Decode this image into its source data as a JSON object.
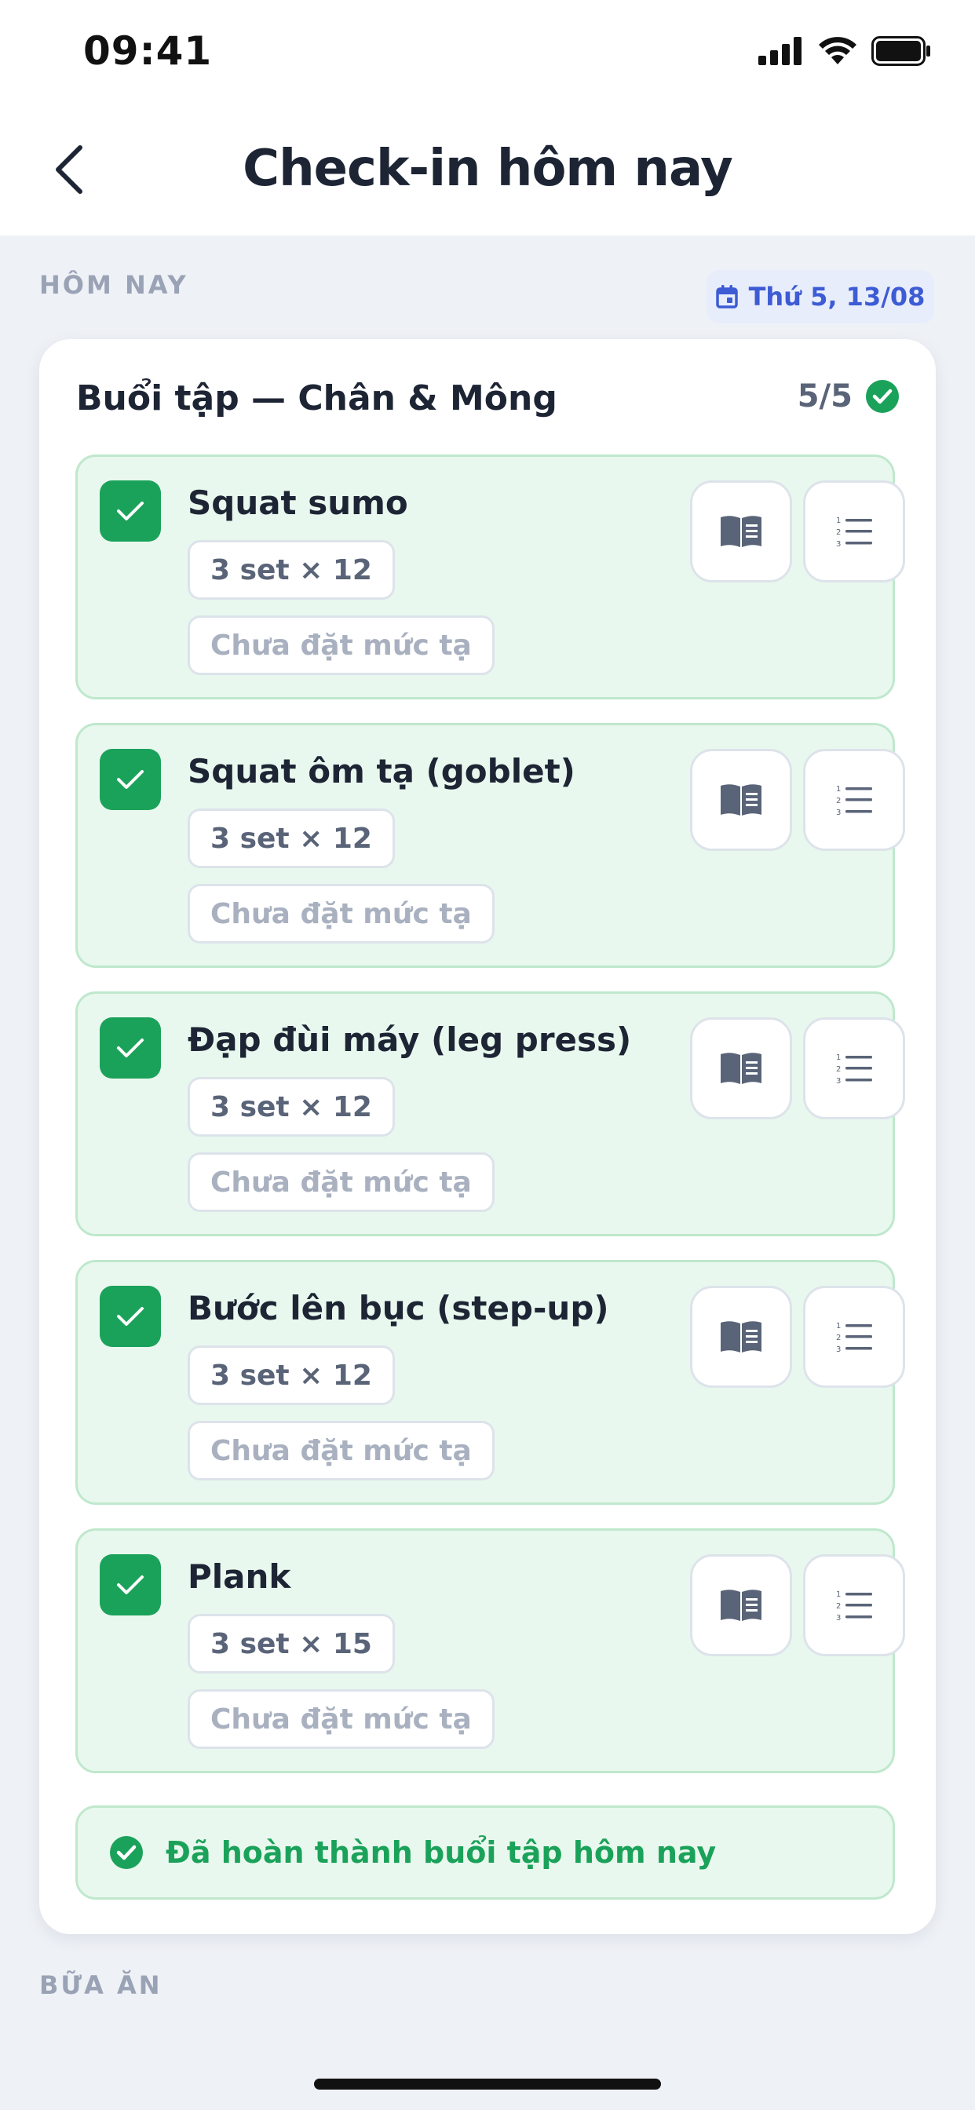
{
  "status_bar": {
    "time": "09:41"
  },
  "header": {
    "title": "Check-in hôm nay"
  },
  "today": {
    "section_label": "HÔM NAY",
    "date_label": "Thứ 5, 13/08"
  },
  "workout": {
    "title": "Buổi tập — Chân & Mông",
    "progress_label": "5/5",
    "exercises": [
      {
        "name": "Squat sumo",
        "sets": "3 set × 12",
        "weight": "Chưa đặt mức tạ"
      },
      {
        "name": "Squat ôm tạ (goblet)",
        "sets": "3 set × 12",
        "weight": "Chưa đặt mức tạ"
      },
      {
        "name": "Đạp đùi máy (leg press)",
        "sets": "3 set × 12",
        "weight": "Chưa đặt mức tạ"
      },
      {
        "name": "Bước lên bục (step-up)",
        "sets": "3 set × 12",
        "weight": "Chưa đặt mức tạ"
      },
      {
        "name": "Plank",
        "sets": "3 set × 15",
        "weight": "Chưa đặt mức tạ"
      }
    ],
    "completed_message": "Đã hoàn thành buổi tập hôm nay"
  },
  "meals": {
    "section_label": "BỮA ĂN"
  },
  "colors": {
    "accent_green": "#1ba25a",
    "accent_blue": "#3d5bd4"
  }
}
